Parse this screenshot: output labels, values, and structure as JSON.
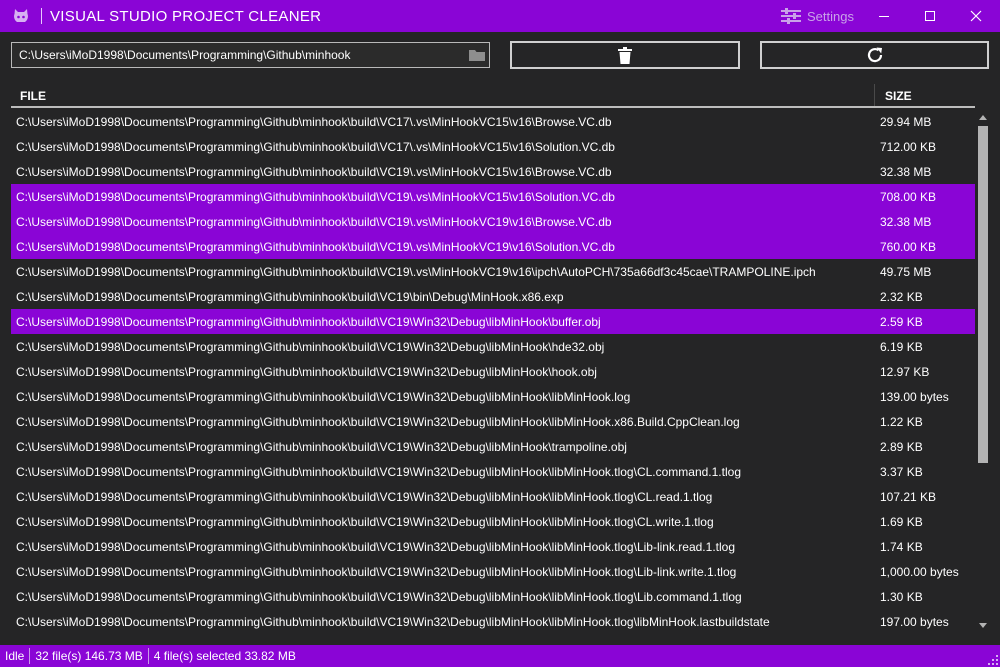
{
  "app": {
    "title": "VISUAL STUDIO PROJECT CLEANER",
    "settings_label": "Settings",
    "accent_color": "#8a05d6"
  },
  "toolbar": {
    "path_value": "C:\\Users\\iMoD1998\\Documents\\Programming\\Github\\minhook",
    "browse_icon": "folder-icon",
    "delete_icon": "trash-icon",
    "refresh_icon": "refresh-icon"
  },
  "table": {
    "columns": {
      "file": "FILE",
      "size": "SIZE"
    },
    "rows": [
      {
        "file": "C:\\Users\\iMoD1998\\Documents\\Programming\\Github\\minhook\\build\\VC17\\.vs\\MinHookVC15\\v16\\Browse.VC.db",
        "size": "29.94 MB",
        "selected": false
      },
      {
        "file": "C:\\Users\\iMoD1998\\Documents\\Programming\\Github\\minhook\\build\\VC17\\.vs\\MinHookVC15\\v16\\Solution.VC.db",
        "size": "712.00 KB",
        "selected": false
      },
      {
        "file": "C:\\Users\\iMoD1998\\Documents\\Programming\\Github\\minhook\\build\\VC19\\.vs\\MinHookVC15\\v16\\Browse.VC.db",
        "size": "32.38 MB",
        "selected": false
      },
      {
        "file": "C:\\Users\\iMoD1998\\Documents\\Programming\\Github\\minhook\\build\\VC19\\.vs\\MinHookVC15\\v16\\Solution.VC.db",
        "size": "708.00 KB",
        "selected": true
      },
      {
        "file": "C:\\Users\\iMoD1998\\Documents\\Programming\\Github\\minhook\\build\\VC19\\.vs\\MinHookVC19\\v16\\Browse.VC.db",
        "size": "32.38 MB",
        "selected": true
      },
      {
        "file": "C:\\Users\\iMoD1998\\Documents\\Programming\\Github\\minhook\\build\\VC19\\.vs\\MinHookVC19\\v16\\Solution.VC.db",
        "size": "760.00 KB",
        "selected": true
      },
      {
        "file": "C:\\Users\\iMoD1998\\Documents\\Programming\\Github\\minhook\\build\\VC19\\.vs\\MinHookVC19\\v16\\ipch\\AutoPCH\\735a66df3c45cae\\TRAMPOLINE.ipch",
        "size": "49.75 MB",
        "selected": false
      },
      {
        "file": "C:\\Users\\iMoD1998\\Documents\\Programming\\Github\\minhook\\build\\VC19\\bin\\Debug\\MinHook.x86.exp",
        "size": "2.32 KB",
        "selected": false
      },
      {
        "file": "C:\\Users\\iMoD1998\\Documents\\Programming\\Github\\minhook\\build\\VC19\\Win32\\Debug\\libMinHook\\buffer.obj",
        "size": "2.59 KB",
        "selected": true
      },
      {
        "file": "C:\\Users\\iMoD1998\\Documents\\Programming\\Github\\minhook\\build\\VC19\\Win32\\Debug\\libMinHook\\hde32.obj",
        "size": "6.19 KB",
        "selected": false
      },
      {
        "file": "C:\\Users\\iMoD1998\\Documents\\Programming\\Github\\minhook\\build\\VC19\\Win32\\Debug\\libMinHook\\hook.obj",
        "size": "12.97 KB",
        "selected": false
      },
      {
        "file": "C:\\Users\\iMoD1998\\Documents\\Programming\\Github\\minhook\\build\\VC19\\Win32\\Debug\\libMinHook\\libMinHook.log",
        "size": "139.00 bytes",
        "selected": false
      },
      {
        "file": "C:\\Users\\iMoD1998\\Documents\\Programming\\Github\\minhook\\build\\VC19\\Win32\\Debug\\libMinHook\\libMinHook.x86.Build.CppClean.log",
        "size": "1.22 KB",
        "selected": false
      },
      {
        "file": "C:\\Users\\iMoD1998\\Documents\\Programming\\Github\\minhook\\build\\VC19\\Win32\\Debug\\libMinHook\\trampoline.obj",
        "size": "2.89 KB",
        "selected": false
      },
      {
        "file": "C:\\Users\\iMoD1998\\Documents\\Programming\\Github\\minhook\\build\\VC19\\Win32\\Debug\\libMinHook\\libMinHook.tlog\\CL.command.1.tlog",
        "size": "3.37 KB",
        "selected": false
      },
      {
        "file": "C:\\Users\\iMoD1998\\Documents\\Programming\\Github\\minhook\\build\\VC19\\Win32\\Debug\\libMinHook\\libMinHook.tlog\\CL.read.1.tlog",
        "size": "107.21 KB",
        "selected": false
      },
      {
        "file": "C:\\Users\\iMoD1998\\Documents\\Programming\\Github\\minhook\\build\\VC19\\Win32\\Debug\\libMinHook\\libMinHook.tlog\\CL.write.1.tlog",
        "size": "1.69 KB",
        "selected": false
      },
      {
        "file": "C:\\Users\\iMoD1998\\Documents\\Programming\\Github\\minhook\\build\\VC19\\Win32\\Debug\\libMinHook\\libMinHook.tlog\\Lib-link.read.1.tlog",
        "size": "1.74 KB",
        "selected": false
      },
      {
        "file": "C:\\Users\\iMoD1998\\Documents\\Programming\\Github\\minhook\\build\\VC19\\Win32\\Debug\\libMinHook\\libMinHook.tlog\\Lib-link.write.1.tlog",
        "size": "1,000.00 bytes",
        "selected": false
      },
      {
        "file": "C:\\Users\\iMoD1998\\Documents\\Programming\\Github\\minhook\\build\\VC19\\Win32\\Debug\\libMinHook\\libMinHook.tlog\\Lib.command.1.tlog",
        "size": "1.30 KB",
        "selected": false
      },
      {
        "file": "C:\\Users\\iMoD1998\\Documents\\Programming\\Github\\minhook\\build\\VC19\\Win32\\Debug\\libMinHook\\libMinHook.tlog\\libMinHook.lastbuildstate",
        "size": "197.00 bytes",
        "selected": false
      }
    ]
  },
  "status": {
    "state": "Idle",
    "summary": "32 file(s) 146.73 MB",
    "selection": "4 file(s) selected 33.82 MB"
  }
}
